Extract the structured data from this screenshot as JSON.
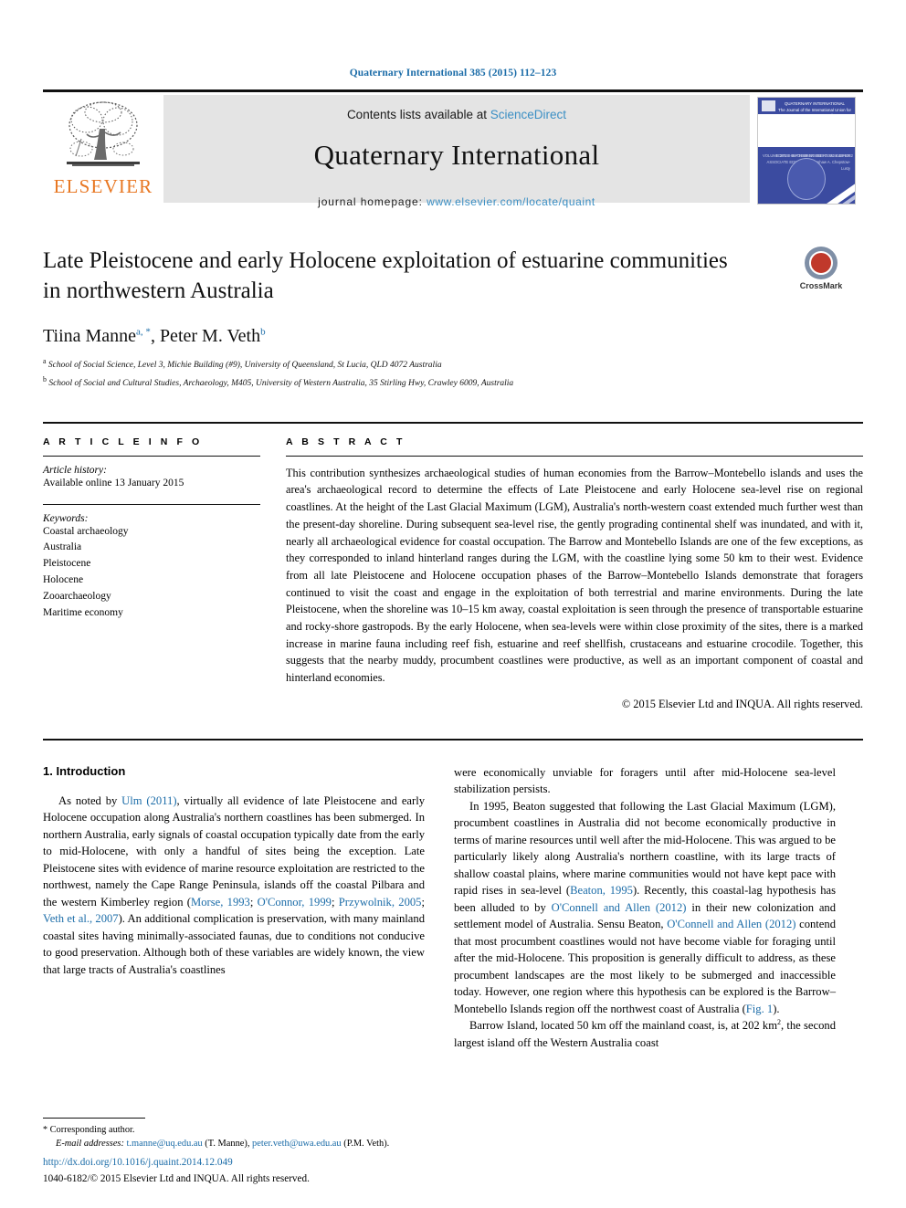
{
  "running_head": "Quaternary International 385 (2015) 112–123",
  "masthead": {
    "publisher_name": "ELSEVIER",
    "contents_prefix": "Contents lists available at ",
    "contents_link": "ScienceDirect",
    "journal_title": "Quaternary International",
    "homepage_label": "journal homepage: ",
    "homepage_url": "www.elsevier.com/locate/quaint",
    "cover": {
      "top_title": "QUATERNARY INTERNATIONAL",
      "top_subtitle": "The Journal of the International Union for Quaternary Research",
      "left_text": "VOLUME 385\n1 SEPTEMBER 2015\nISSN 1040-6182",
      "right_text": "EDITOR-IN-CHIEF\nNORBERT SCHLEIFER\nASSOCIATE EDITORS\nP. Kershaw\nA. Chepstow-Lusty",
      "emblem_text": "INQUA 1928"
    }
  },
  "article": {
    "title": "Late Pleistocene and early Holocene exploitation of estuarine communities in northwestern Australia",
    "crossmark_label": "CrossMark",
    "authors": [
      {
        "name": "Tiina Manne",
        "marks": "a, *"
      },
      {
        "name": "Peter M. Veth",
        "marks": "b"
      }
    ],
    "authors_line": "Tiina Manne",
    "affiliations": [
      {
        "mark": "a",
        "text": "School of Social Science, Level 3, Michie Building (#9), University of Queensland, St Lucia, QLD 4072 Australia"
      },
      {
        "mark": "b",
        "text": "School of Social and Cultural Studies, Archaeology, M405, University of Western Australia, 35 Stirling Hwy, Crawley 6009, Australia"
      }
    ]
  },
  "article_info": {
    "heading": "A R T I C L E  I N F O",
    "history_label": "Article history:",
    "history_value": "Available online 13 January 2015",
    "keywords_label": "Keywords:",
    "keywords": [
      "Coastal archaeology",
      "Australia",
      "Pleistocene",
      "Holocene",
      "Zooarchaeology",
      "Maritime economy"
    ]
  },
  "abstract": {
    "heading": "A B S T R A C T",
    "text": "This contribution synthesizes archaeological studies of human economies from the Barrow–Montebello islands and uses the area's archaeological record to determine the effects of Late Pleistocene and early Holocene sea-level rise on regional coastlines. At the height of the Last Glacial Maximum (LGM), Australia's north-western coast extended much further west than the present-day shoreline. During subsequent sea-level rise, the gently prograding continental shelf was inundated, and with it, nearly all archaeological evidence for coastal occupation. The Barrow and Montebello Islands are one of the few exceptions, as they corresponded to inland hinterland ranges during the LGM, with the coastline lying some 50 km to their west. Evidence from all late Pleistocene and Holocene occupation phases of the Barrow–Montebello Islands demonstrate that foragers continued to visit the coast and engage in the exploitation of both terrestrial and marine environments. During the late Pleistocene, when the shoreline was 10–15 km away, coastal exploitation is seen through the presence of transportable estuarine and rocky-shore gastropods. By the early Holocene, when sea-levels were within close proximity of the sites, there is a marked increase in marine fauna including reef fish, estuarine and reef shellfish, crustaceans and estuarine crocodile. Together, this suggests that the nearby muddy, procumbent coastlines were productive, as well as an important component of coastal and hinterland economies.",
    "copyright": "© 2015 Elsevier Ltd and INQUA. All rights reserved."
  },
  "body": {
    "section_heading": "1. Introduction",
    "left_column": {
      "p1_a": "As noted by ",
      "p1_ref1": "Ulm (2011)",
      "p1_b": ", virtually all evidence of late Pleistocene and early Holocene occupation along Australia's northern coastlines has been submerged. In northern Australia, early signals of coastal occupation typically date from the early to mid-Holocene, with only a handful of sites being the exception. Late Pleistocene sites with evidence of marine resource exploitation are restricted to the northwest, namely the Cape Range Peninsula, islands off the coastal Pilbara and the western Kimberley region (",
      "p1_ref2": "Morse, 1993",
      "p1_sep1": "; ",
      "p1_ref3": "O'Connor, 1999",
      "p1_sep2": "; ",
      "p1_ref4": "Przywolnik, 2005",
      "p1_sep3": "; ",
      "p1_ref5": "Veth et al., 2007",
      "p1_c": "). An additional complication is preservation, with many mainland coastal sites having minimally-associated faunas, due to conditions not conducive to good preservation. Although both of these variables are widely known, the view that large tracts of Australia's coastlines"
    },
    "right_column": {
      "p1_cont": "were economically unviable for foragers until after mid-Holocene sea-level stabilization persists.",
      "p2_a": "In 1995, Beaton suggested that following the Last Glacial Maximum (LGM), procumbent coastlines in Australia did not become economically productive in terms of marine resources until well after the mid-Holocene. This was argued to be particularly likely along Australia's northern coastline, with its large tracts of shallow coastal plains, where marine communities would not have kept pace with rapid rises in sea-level (",
      "p2_ref1": "Beaton, 1995",
      "p2_b": "). Recently, this coastal-lag hypothesis has been alluded to by ",
      "p2_ref2": "O'Connell and Allen (2012)",
      "p2_c": " in their new colonization and settlement model of Australia. Sensu Beaton, ",
      "p2_ref3": "O'Connell and Allen (2012)",
      "p2_d": " contend that most procumbent coastlines would not have become viable for foraging until after the mid-Holocene. This proposition is generally difficult to address, as these procumbent landscapes are the most likely to be submerged and inaccessible today. However, one region where this hypothesis can be explored is the Barrow–Montebello Islands region off the northwest coast of Australia (",
      "p2_ref4": "Fig. 1",
      "p2_e": ").",
      "p3_a": "Barrow Island, located 50 km off the mainland coast, is, at 202 km",
      "p3_sup": "2",
      "p3_b": ", the second largest island off the Western Australia coast"
    }
  },
  "footer": {
    "corresponding_marker": "*",
    "corresponding_label": " Corresponding author.",
    "email_label": "E-mail addresses:",
    "email1": "t.manne@uq.edu.au",
    "email1_owner": " (T. Manne), ",
    "email2": "peter.veth@uwa.edu.au",
    "email2_owner": "(P.M. Veth).",
    "doi": "http://dx.doi.org/10.1016/j.quaint.2014.12.049",
    "issn_line": "1040-6182/© 2015 Elsevier Ltd and INQUA. All rights reserved."
  },
  "colors": {
    "link_blue": "#1b6ca8",
    "sciencedirect_blue": "#3b8fc4",
    "elsevier_orange": "#e87722",
    "cover_blue": "#3b4ba0",
    "masthead_gray": "#e4e4e4"
  }
}
